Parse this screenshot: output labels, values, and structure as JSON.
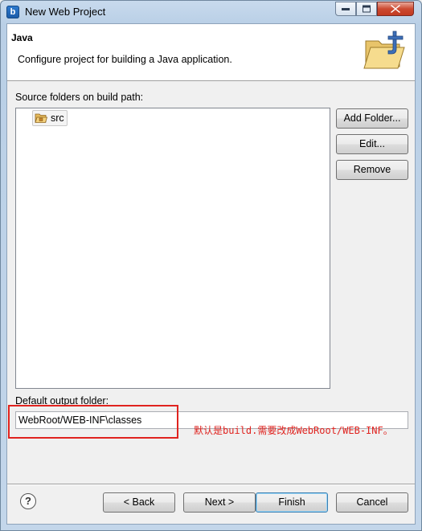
{
  "window": {
    "title": "New Web Project",
    "app_icon_glyph": "b"
  },
  "banner": {
    "title": "Java",
    "description": "Configure project for building a Java application.",
    "icon": "java-folder-icon"
  },
  "source": {
    "label": "Source folders on build path:",
    "items": [
      {
        "label": "src",
        "icon": "package-folder-icon"
      }
    ]
  },
  "side_buttons": {
    "add_folder": "Add Folder...",
    "edit": "Edit...",
    "remove": "Remove"
  },
  "output": {
    "label": "Default output folder:",
    "value": "WebRoot/WEB-INF\\classes"
  },
  "annotation": {
    "text": "默认是build.需要改成WebRoot/WEB-INF。",
    "color": "#e0231f"
  },
  "footer": {
    "back": "< Back",
    "next": "Next >",
    "finish": "Finish",
    "cancel": "Cancel"
  }
}
